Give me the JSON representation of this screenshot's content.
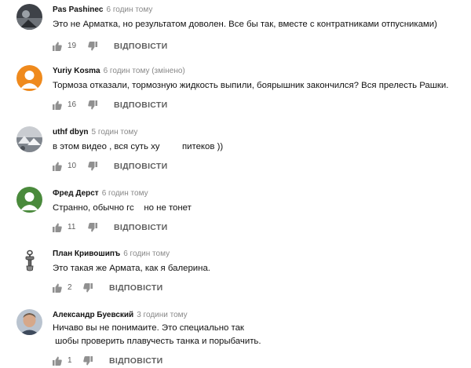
{
  "comments": [
    {
      "author": "Pas Pashinec",
      "time": "6 годин тому",
      "lines": [
        "Это не Арматка, но результатом доволен. Все бы так, вместе с контратниками отпусниками)"
      ],
      "likes": "19",
      "reply": "ВІДПОВІСТИ",
      "avatar": "photo-dark"
    },
    {
      "author": "Yuriy Kosma",
      "time": "6 годин тому (змінено)",
      "lines": [
        "Тормоза отказали, тормозную жидкость выпили, боярышник закончился? Вся прелесть Рашки."
      ],
      "likes": "16",
      "reply": "ВІДПОВІСТИ",
      "avatar": "default-orange"
    },
    {
      "author": "uthf dbyn",
      "time": "5 годин тому",
      "lines": [
        "в этом видео , вся суть ху         питеков ))"
      ],
      "likes": "10",
      "reply": "ВІДПОВІСТИ",
      "avatar": "photo-snow"
    },
    {
      "author": "Фред Дерст",
      "time": "6 годин тому",
      "lines": [
        "Странно, обычно гс    но не тонет"
      ],
      "likes": "11",
      "reply": "ВІДПОВІСТИ",
      "avatar": "default-green"
    },
    {
      "author": "План Кривошипъ",
      "time": "6 годин тому",
      "lines": [
        "Это такая же Армата, как я балерина."
      ],
      "likes": "2",
      "reply": "ВІДПОВІСТИ",
      "avatar": "hook-icon"
    },
    {
      "author": "Александр Буевский",
      "time": "3 години тому",
      "lines": [
        "Ничаво вы не понимаите. Это специально так",
        " шобы проверить плавучесть танка и порыбачить."
      ],
      "likes": "1",
      "reply": "ВІДПОВІСТИ",
      "avatar": "photo-face"
    }
  ]
}
